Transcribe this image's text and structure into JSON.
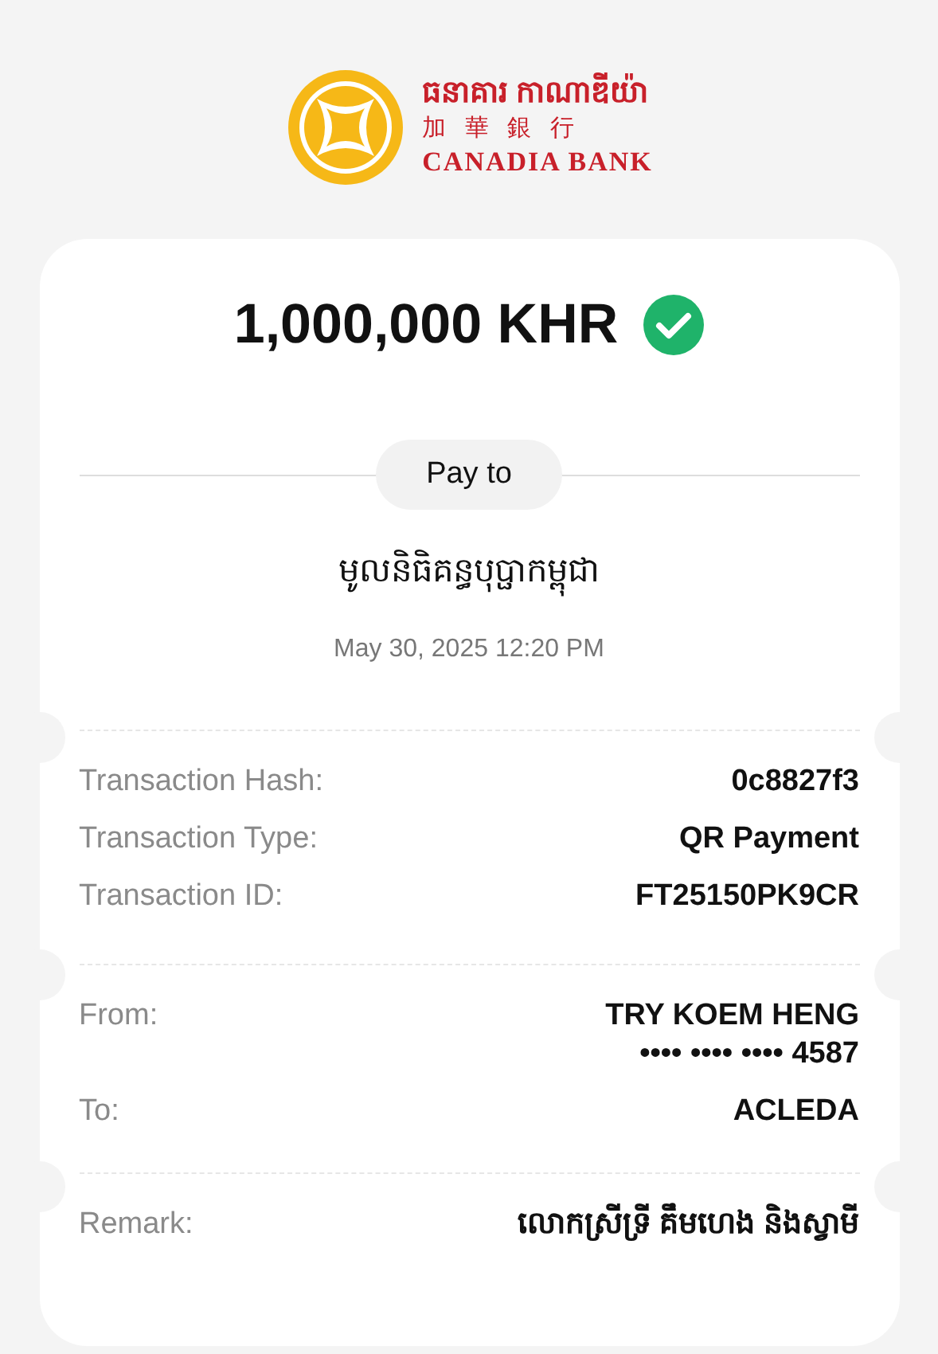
{
  "bank": {
    "name_khmer": "ធនាគារ កាណាឌីយ៉ា",
    "name_chinese": "加 華 銀 行",
    "name_english": "CANADIA BANK"
  },
  "amount": "1,000,000 KHR",
  "success": true,
  "pay_to": {
    "label": "Pay to",
    "recipient": "មូលនិធិគន្ធបុប្ផាកម្ពុជា",
    "datetime": "May 30, 2025 12:20 PM"
  },
  "sections": [
    {
      "rows": [
        {
          "label": "Transaction Hash:",
          "values": [
            "0c8827f3"
          ]
        },
        {
          "label": "Transaction Type:",
          "values": [
            "QR Payment"
          ]
        },
        {
          "label": "Transaction ID:",
          "values": [
            "FT25150PK9CR"
          ]
        }
      ]
    },
    {
      "rows": [
        {
          "label": "From:",
          "values": [
            "TRY KOEM HENG",
            "•••• •••• •••• 4587"
          ]
        },
        {
          "label": "To:",
          "values": [
            "ACLEDA"
          ]
        }
      ]
    },
    {
      "rows": [
        {
          "label": "Remark:",
          "values": [
            "លោកស្រីទ្រី គឹមហេង និងស្វាមី"
          ]
        }
      ]
    }
  ]
}
